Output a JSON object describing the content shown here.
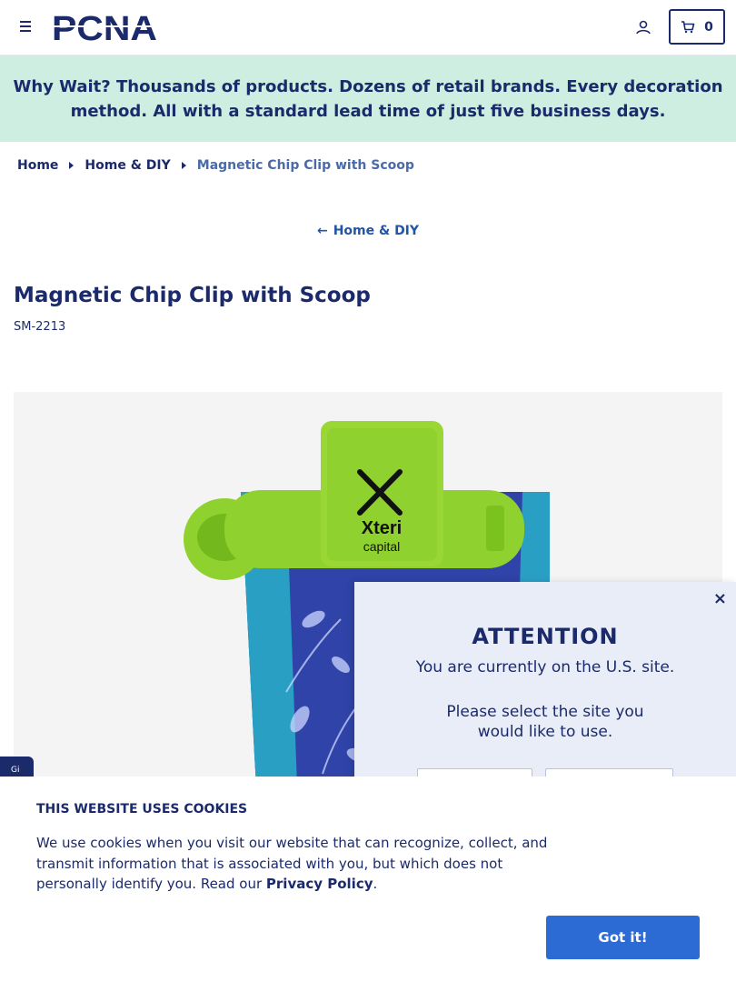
{
  "header": {
    "logo_text": "PCNA",
    "cart_count": "0"
  },
  "banner": {
    "bold_text": "Why Wait?",
    "text": " Thousands of products. Dozens of retail brands. Every decoration method. All with a standard lead time of just five business days."
  },
  "breadcrumb": {
    "items": [
      "Home",
      "Home & DIY"
    ],
    "current": "Magnetic Chip Clip with Scoop"
  },
  "back_link": {
    "arrow": "←",
    "label": "Home & DIY"
  },
  "product": {
    "title": "Magnetic Chip Clip with Scoop",
    "sku": "SM-2213",
    "image_brand_text": "Xteri",
    "image_brand_sub": "capital"
  },
  "side_tab": {
    "label": "Gi"
  },
  "attention": {
    "close": "×",
    "heading": "ATTENTION",
    "line1": "You are currently on the U.S. site.",
    "line2": "Please select the site you would like to use."
  },
  "cookie": {
    "heading": "THIS WEBSITE USES COOKIES",
    "text": "We use cookies when you visit our website that can recognize, collect, and transmit information that is associated with you, but which does not personally identify you. Read our ",
    "link": "Privacy Policy",
    "after": ".",
    "button": "Got it!"
  },
  "colors": {
    "navy": "#1b2a6b",
    "banner_bg": "#cdeee0",
    "button_blue": "#2d6bd4",
    "modal_bg": "#e8edf8",
    "product_green": "#8fd12e"
  }
}
